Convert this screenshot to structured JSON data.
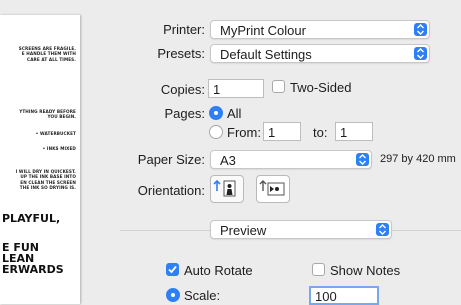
{
  "preview_page": {
    "block1": [
      "SCREENS ARE FRAGILE.",
      "E HANDLE THEM WITH",
      "CARE AT ALL TIMES."
    ],
    "block2": [
      "YTHING READY BEFORE",
      "YOU BEGIN."
    ],
    "item1": "• WATERBUCKET",
    "item2": "• INKS MIXED",
    "block3": [
      "I WILL DRY IN QUICKEST.",
      "UP THE INK BASE INTO",
      "EN CLEAN THE SCREEN",
      "THE INK SO DRYING IS."
    ],
    "big1": "PLAYFUL,",
    "big2": [
      "E FUN",
      "LEAN",
      "ERWARDS"
    ]
  },
  "printer": {
    "label": "Printer:",
    "value": "MyPrint Colour"
  },
  "presets": {
    "label": "Presets:",
    "value": "Default Settings"
  },
  "copies": {
    "label": "Copies:",
    "value": "1",
    "two_sided_label": "Two-Sided",
    "two_sided_checked": false
  },
  "pages": {
    "label": "Pages:",
    "all_label": "All",
    "from_label": "From:",
    "from_value": "1",
    "to_label": "to:",
    "to_value": "1",
    "selected": "all"
  },
  "paper_size": {
    "label": "Paper Size:",
    "value": "A3",
    "dimensions": "297 by 420 mm"
  },
  "orientation": {
    "label": "Orientation:",
    "selected": "portrait"
  },
  "section_popup": {
    "value": "Preview"
  },
  "auto_rotate": {
    "label": "Auto Rotate",
    "checked": true
  },
  "show_notes": {
    "label": "Show Notes",
    "checked": false
  },
  "scale": {
    "label": "Scale:",
    "value": "100",
    "selected": true
  },
  "colors": {
    "accent": "#2f7ff5",
    "background": "#ececec"
  }
}
